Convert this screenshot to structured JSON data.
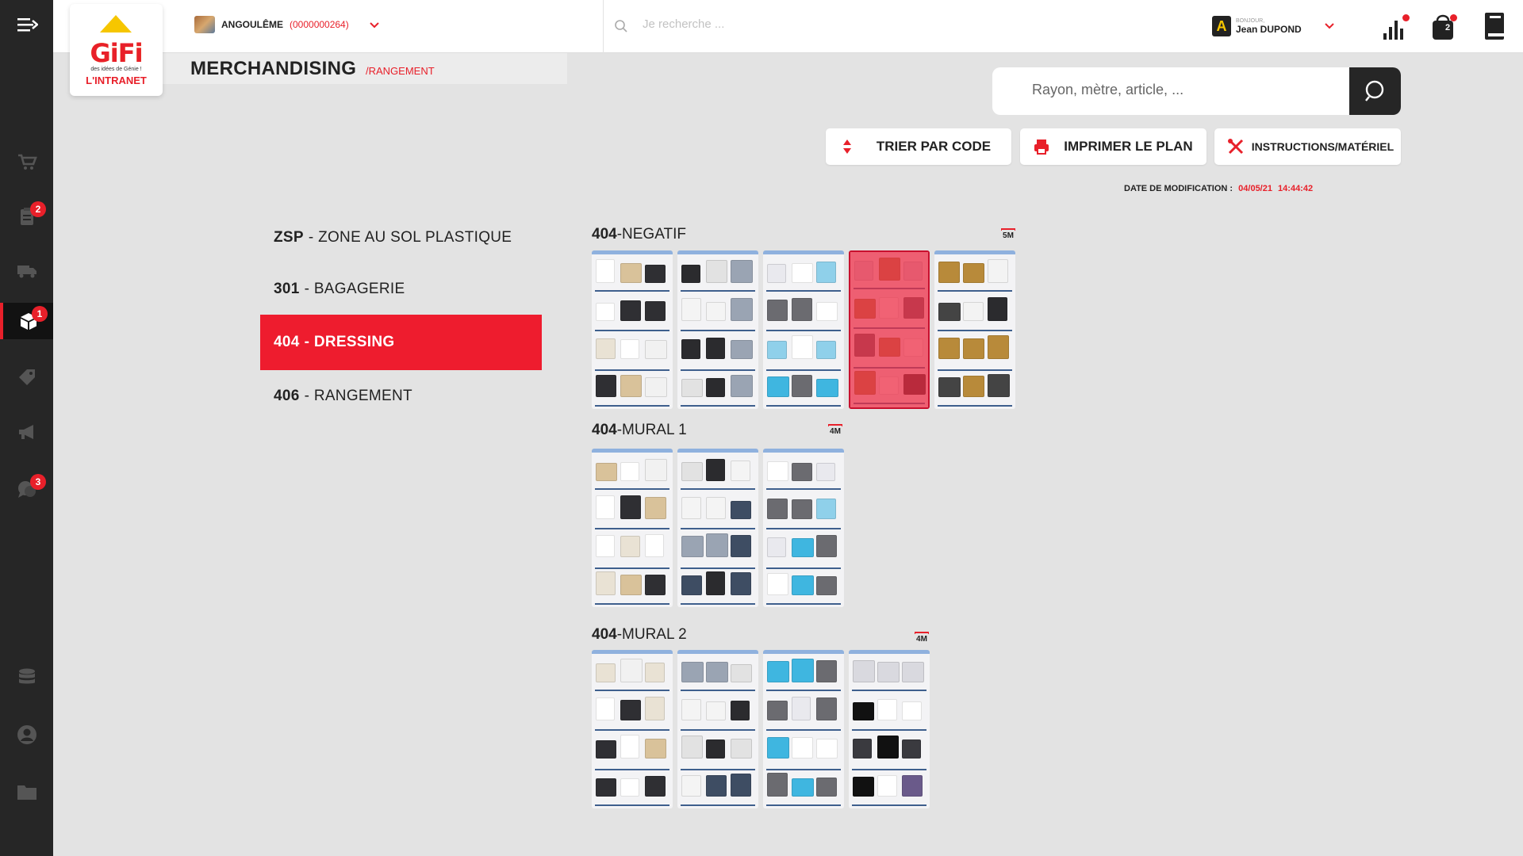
{
  "header": {
    "store_name": "ANGOULÊME",
    "store_code": "(0000000264)",
    "search_placeholder": "Je recherche ...",
    "user_greeting": "BONJOUR,",
    "user_name": "Jean DUPOND",
    "user_initial": "A",
    "cart_count": "2"
  },
  "logo": {
    "brand": "GiFi",
    "tagline": "des idées de Génie !",
    "product": "L'INTRANET"
  },
  "sidebar": {
    "items": [
      {
        "icon": "cart-icon",
        "badge": ""
      },
      {
        "icon": "clipboard-icon",
        "badge": "2"
      },
      {
        "icon": "truck-icon",
        "badge": ""
      },
      {
        "icon": "boxes-icon",
        "badge": "1",
        "active": true
      },
      {
        "icon": "tag-icon",
        "badge": ""
      },
      {
        "icon": "megaphone-icon",
        "badge": ""
      },
      {
        "icon": "chat-icon",
        "badge": "3"
      },
      {
        "icon": "database-icon",
        "badge": ""
      },
      {
        "icon": "user-icon",
        "badge": ""
      },
      {
        "icon": "folder-icon",
        "badge": ""
      }
    ]
  },
  "page": {
    "title": "MERCHANDISING",
    "subtitle": "/RANGEMENT"
  },
  "search": {
    "placeholder": "Rayon, mètre, article, ..."
  },
  "actions": {
    "sort_label": "TRIER PAR CODE",
    "print_label": "IMPRIMER LE PLAN",
    "instructions_label": "INSTRUCTIONS/MATÉRIEL"
  },
  "modification": {
    "label": "DATE DE MODIFICATION :",
    "date": "04/05/21",
    "time": "14:44:42"
  },
  "categories": [
    {
      "code": "ZSP",
      "name": "- ZONE AU SOL PLASTIQUE",
      "active": false
    },
    {
      "code": "301",
      "name": " - BAGAGERIE",
      "active": false
    },
    {
      "code": "404",
      "name": "- DRESSING",
      "active": true
    },
    {
      "code": "406",
      "name": "- RANGEMENT",
      "active": false
    }
  ],
  "sections": [
    {
      "code": "404",
      "name": "-NEGATIF",
      "size": "5M",
      "bays": 5,
      "selected_bay": 4
    },
    {
      "code": "404",
      "name": "-MURAL 1",
      "size": "4M",
      "bays": 3,
      "selected_bay": 0
    },
    {
      "code": "404",
      "name": "-MURAL 2",
      "size": "4M",
      "bays": 4,
      "selected_bay": 0
    }
  ]
}
